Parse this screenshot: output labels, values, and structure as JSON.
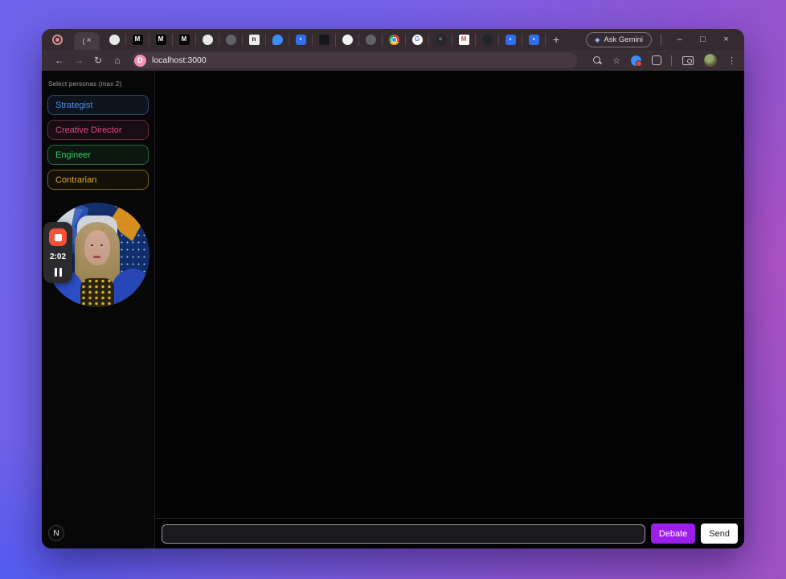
{
  "browser": {
    "active_tab": {
      "label": "(",
      "close": "×"
    },
    "tabs": [
      {
        "icon": "chatgpt-icon",
        "bg": "#e8e8e8",
        "fg": "#555",
        "glyph": "",
        "radius": "50%"
      },
      {
        "icon": "medium-icon",
        "bg": "#060606",
        "fg": "#fff",
        "glyph": "M",
        "radius": "2px"
      },
      {
        "icon": "medium-icon",
        "bg": "#060606",
        "fg": "#fff",
        "glyph": "M",
        "radius": "2px"
      },
      {
        "icon": "medium-icon",
        "bg": "#060606",
        "fg": "#fff",
        "glyph": "M",
        "radius": "2px"
      },
      {
        "icon": "chatgpt-icon",
        "bg": "#e8e8e8",
        "fg": "#555",
        "glyph": "",
        "radius": "50%"
      },
      {
        "icon": "globe-icon",
        "bg": "#5f6368",
        "fg": "#aab",
        "glyph": "",
        "radius": "50%"
      },
      {
        "icon": "notion-icon",
        "bg": "#ededed",
        "fg": "#111",
        "glyph": "n",
        "radius": "2px"
      },
      {
        "icon": "bluesky-icon",
        "bg": "#3d8bfd",
        "fg": "#cfe3ff",
        "glyph": "",
        "radius": "50% 50% 50% 20%"
      },
      {
        "icon": "app-blue-icon",
        "bg": "#2f6fed",
        "fg": "#fff",
        "glyph": "▪",
        "radius": "3px"
      },
      {
        "icon": "black-app-icon",
        "bg": "#18181a",
        "fg": "#ddd",
        "glyph": "",
        "radius": "3px"
      },
      {
        "icon": "github-icon",
        "bg": "#f2f2f2",
        "fg": "#222",
        "glyph": "",
        "radius": "50%"
      },
      {
        "icon": "globe-icon",
        "bg": "#5f6368",
        "fg": "#aab",
        "glyph": "",
        "radius": "50%"
      },
      {
        "icon": "chrome-icon",
        "bg": "radial-gradient(circle, #4285f4 0 2.5px, #fff 2.5px 3.5px, transparent 3.5px), conic-gradient(#ea4335 0 33%, #fbbc05 33% 66%, #34a853 66%)",
        "fg": "#fff",
        "glyph": "",
        "radius": "50%"
      },
      {
        "icon": "google-icon",
        "bg": "#ffffff",
        "fg": "#4285f4",
        "glyph": "G",
        "radius": "50%"
      },
      {
        "icon": "chart-icon",
        "bg": "#26282b",
        "fg": "#9aa0a6",
        "glyph": "≡",
        "radius": "2px"
      },
      {
        "icon": "gmail-icon",
        "bg": "#ffffff",
        "fg": "#ea4335",
        "glyph": "M",
        "radius": "2px"
      },
      {
        "icon": "github-icon",
        "bg": "#23272b",
        "fg": "#eee",
        "glyph": "",
        "radius": "50%"
      },
      {
        "icon": "app-blue-icon",
        "bg": "#2f6fed",
        "fg": "#fff",
        "glyph": "▪",
        "radius": "3px"
      },
      {
        "icon": "app-blue-icon",
        "bg": "#2f6fed",
        "fg": "#fff",
        "glyph": "▪",
        "radius": "3px"
      }
    ],
    "new_tab": "+",
    "ask_gemini": {
      "icon": "gemini-icon",
      "label": "Ask Gemini"
    },
    "window_controls": {
      "minimize": "–",
      "maximize": "□",
      "close": "×"
    },
    "toolbar": {
      "back": "←",
      "forward": "→",
      "reload": "↻",
      "home": "⌂",
      "url": "localhost:3000",
      "url_favicon_glyph": "D",
      "star": "☆",
      "menu": "⋮"
    }
  },
  "app": {
    "sidebar": {
      "heading": "Select personas (max 2)",
      "personas": [
        {
          "name": "persona-button-strategist",
          "label": "Strategist",
          "color": "#4f8ef0",
          "border": "#2c4a72",
          "bg": "#0d141d"
        },
        {
          "name": "persona-button-creative-director",
          "label": "Creative Director",
          "color": "#e24b82",
          "border": "#63293f",
          "bg": "#170d12"
        },
        {
          "name": "persona-button-engineer",
          "label": "Engineer",
          "color": "#35c768",
          "border": "#2a6b40",
          "bg": "#0c1710"
        },
        {
          "name": "persona-button-contrarian",
          "label": "Contrarian",
          "color": "#d9a733",
          "border": "#77611f",
          "bg": "#151006"
        }
      ],
      "recorder": {
        "time": "2:02"
      },
      "nextjs_badge_label": "N"
    },
    "composer": {
      "input_value": "",
      "input_placeholder": "",
      "debate_label": "Debate",
      "send_label": "Send"
    },
    "accent_colors": {
      "debate_purple": "#9c1fe9",
      "send_white": "#ffffff"
    }
  }
}
